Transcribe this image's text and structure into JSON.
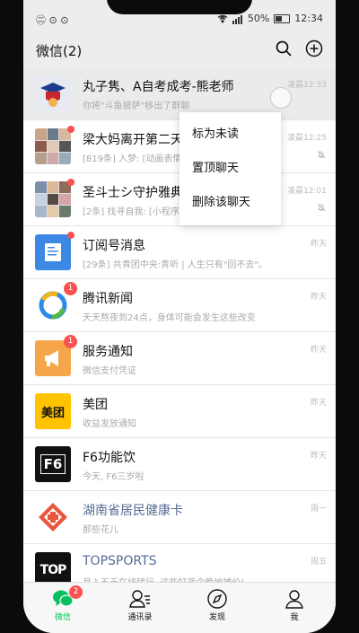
{
  "statusbar": {
    "left": "㊁ ⊙ ⊙",
    "battery": "50%",
    "time": "12:34"
  },
  "header": {
    "title": "微信(2)"
  },
  "colors": {
    "accent": "#07c160",
    "badge": "#fa5151",
    "link_name": "#576b95"
  },
  "chats": [
    {
      "name": "丸子隽、A自考成考-熊老师",
      "preview": "你将\"斗鱼披萨\"移出了群聊",
      "time": "凌晨12:33",
      "muted": false,
      "avatar_icon": "graduate-icon"
    },
    {
      "name": "梁大妈离开第二天",
      "preview": "[819条] 入梦: [动画表情]",
      "time": "凌晨12:25",
      "muted": true,
      "avatar_icon": "group-photo-icon"
    },
    {
      "name": "圣斗士シ守护雅典",
      "preview": "[2条] 找寻自我: [小程序]",
      "time": "凌晨12:01",
      "muted": true,
      "avatar_icon": "group-photo-icon"
    },
    {
      "name": "订阅号消息",
      "preview": "[29条] 共青团中央:青听 | 人生只有\"回不去\"。",
      "time": "昨天",
      "muted": false,
      "avatar_icon": "subscription-icon"
    },
    {
      "name": "腾讯新闻",
      "preview": "天天熬夜到24点，身体可能会发生这些改变",
      "time": "昨天",
      "muted": false,
      "badge": "1",
      "avatar_icon": "tencent-news-icon"
    },
    {
      "name": "服务通知",
      "preview": "微信支付凭证",
      "time": "昨天",
      "muted": false,
      "badge": "1",
      "avatar_icon": "megaphone-icon"
    },
    {
      "name": "美团",
      "preview": "收益发放通知",
      "time": "昨天",
      "muted": false,
      "avatar_icon": "meituan-logo"
    },
    {
      "name": "F6功能饮",
      "preview": "今天, F6三岁啦",
      "time": "昨天",
      "muted": false,
      "avatar_icon": "f6-logo"
    },
    {
      "name": "湖南省居民健康卡",
      "preview": "那些花儿",
      "time": "周一",
      "muted": false,
      "avatar_icon": "health-cross-icon"
    },
    {
      "name": "TOPSPORTS",
      "preview": "月入五千在线转行, 这些好货今晚地摊价!",
      "time": "周五",
      "muted": false,
      "avatar_icon": "topsports-logo"
    }
  ],
  "avatar_text": {
    "meituan": "美团",
    "f6": "F6",
    "top": "TOP"
  },
  "context_menu": {
    "items": [
      "标为未读",
      "置顶聊天",
      "删除该聊天"
    ]
  },
  "tabs": [
    {
      "label": "微信",
      "badge": "2",
      "icon": "chat-bubble-icon",
      "active": true
    },
    {
      "label": "通讯录",
      "icon": "contacts-icon",
      "active": false
    },
    {
      "label": "发现",
      "icon": "compass-icon",
      "active": false
    },
    {
      "label": "我",
      "icon": "person-icon",
      "active": false
    }
  ]
}
